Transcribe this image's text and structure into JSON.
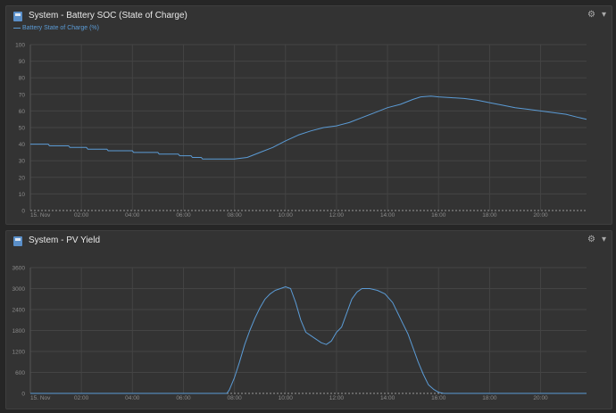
{
  "theme": {
    "line_color": "#5b9bd5",
    "grid_color": "#444444",
    "axis_text": "#8b8b8b",
    "panel_bg": "#333333",
    "page_bg": "#262626"
  },
  "panels": [
    {
      "title": "System - Battery SOC (State of Charge)",
      "legend": "Battery State of Charge (%)",
      "icons": {
        "app": "system-icon",
        "settings": "gear-icon",
        "collapse": "collapse-icon"
      }
    },
    {
      "title": "System - PV Yield",
      "icons": {
        "app": "system-icon",
        "settings": "gear-icon",
        "collapse": "collapse-icon"
      }
    }
  ],
  "chart_data": [
    {
      "type": "line",
      "title": "System - Battery SOC (State of Charge)",
      "ylim": [
        0,
        100
      ],
      "yticks": [
        0,
        10,
        20,
        30,
        40,
        50,
        60,
        70,
        80,
        90,
        100
      ],
      "xlim": [
        0,
        21.8
      ],
      "xticks": [
        0,
        2,
        4,
        6,
        8,
        10,
        12,
        14,
        16,
        18,
        20
      ],
      "xtick_labels": [
        "15. Nov",
        "02:00",
        "04:00",
        "06:00",
        "08:00",
        "10:00",
        "12:00",
        "14:00",
        "16:00",
        "18:00",
        "20:00"
      ],
      "grid": true,
      "series": [
        {
          "name": "Battery State of Charge (%)",
          "x": [
            0,
            0.7,
            0.75,
            1.5,
            1.55,
            2.2,
            2.25,
            3,
            3.05,
            4,
            4.05,
            5,
            5.05,
            5.8,
            5.85,
            6.3,
            6.35,
            6.7,
            6.75,
            7.5,
            8.0,
            8.5,
            9.0,
            9.5,
            10.0,
            10.5,
            11.0,
            11.5,
            12.0,
            12.5,
            13.0,
            13.5,
            14.0,
            14.5,
            15.0,
            15.3,
            15.7,
            16.0,
            16.5,
            17.0,
            17.5,
            18.0,
            18.5,
            19.0,
            19.5,
            20.0,
            20.5,
            21.0,
            21.5,
            21.8
          ],
          "y": [
            40,
            40,
            39,
            39,
            38,
            38,
            37,
            37,
            36,
            36,
            35,
            35,
            34,
            34,
            33,
            33,
            32,
            32,
            31,
            31,
            31,
            32,
            35,
            38,
            42,
            45.5,
            48,
            50,
            51,
            53,
            56,
            59,
            62,
            64,
            67,
            68.5,
            69,
            68.5,
            68,
            67.5,
            66.5,
            65,
            63.5,
            62,
            61,
            60,
            59,
            58,
            56,
            55
          ]
        }
      ]
    },
    {
      "type": "line",
      "title": "System - PV Yield",
      "ylim": [
        0,
        3600
      ],
      "yticks": [
        0,
        600,
        1200,
        1800,
        2400,
        3000,
        3600
      ],
      "xlim": [
        0,
        21.8
      ],
      "xticks": [
        0,
        2,
        4,
        6,
        8,
        10,
        12,
        14,
        16,
        18,
        20
      ],
      "xtick_labels": [
        "15. Nov",
        "02:00",
        "04:00",
        "06:00",
        "08:00",
        "10:00",
        "12:00",
        "14:00",
        "16:00",
        "18:00",
        "20:00"
      ],
      "grid": true,
      "series": [
        {
          "name": "",
          "x": [
            0,
            7.7,
            7.8,
            8.0,
            8.2,
            8.4,
            8.6,
            8.8,
            9.0,
            9.2,
            9.4,
            9.6,
            9.8,
            10.0,
            10.2,
            10.4,
            10.6,
            10.8,
            11.0,
            11.2,
            11.4,
            11.6,
            11.8,
            12.0,
            12.2,
            12.4,
            12.6,
            12.8,
            13.0,
            13.3,
            13.6,
            13.9,
            14.2,
            14.4,
            14.6,
            14.8,
            15.0,
            15.2,
            15.4,
            15.6,
            15.8,
            16.0,
            16.2,
            21.8
          ],
          "y": [
            0,
            0,
            100,
            450,
            900,
            1400,
            1800,
            2150,
            2450,
            2700,
            2850,
            2950,
            3000,
            3050,
            3000,
            2600,
            2100,
            1750,
            1650,
            1550,
            1450,
            1400,
            1500,
            1750,
            1900,
            2300,
            2700,
            2900,
            3000,
            3000,
            2950,
            2850,
            2600,
            2300,
            2000,
            1700,
            1300,
            900,
            550,
            250,
            120,
            30,
            0,
            0
          ]
        }
      ]
    }
  ]
}
